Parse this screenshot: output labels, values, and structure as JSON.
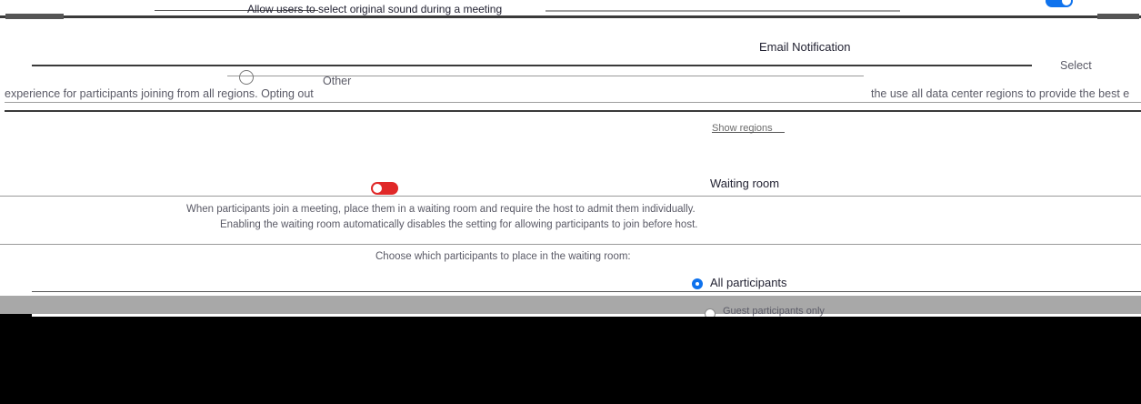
{
  "settings": {
    "original_sound": {
      "label": "Allow users to select original sound during a meeting",
      "enabled": true
    },
    "email_notification_label": "Email Notification",
    "data_center": {
      "other_label": "Other",
      "description": "experience for participants joining from all regions. Opting out",
      "description_right": "the use all data center regions to provide the best e",
      "show_regions_label": "Show regions"
    },
    "waiting_room": {
      "title": "Waiting room",
      "description": "When participants join a meeting, place them in a waiting room and require the host to admit them individually.",
      "note": "Enabling the waiting room automatically disables the setting for allowing participants to join before host.",
      "enabled": true,
      "choose_label": "Choose which participants to place in the waiting room:",
      "options": [
        {
          "label": "All participants",
          "selected": true
        },
        {
          "label": "Guest participants only",
          "selected": false
        }
      ]
    },
    "select_label": "Select"
  },
  "colors": {
    "toggle_on": "#0e72ed",
    "toggle_red": "#e02828",
    "text": "#232333",
    "muted": "#5a5a66"
  }
}
